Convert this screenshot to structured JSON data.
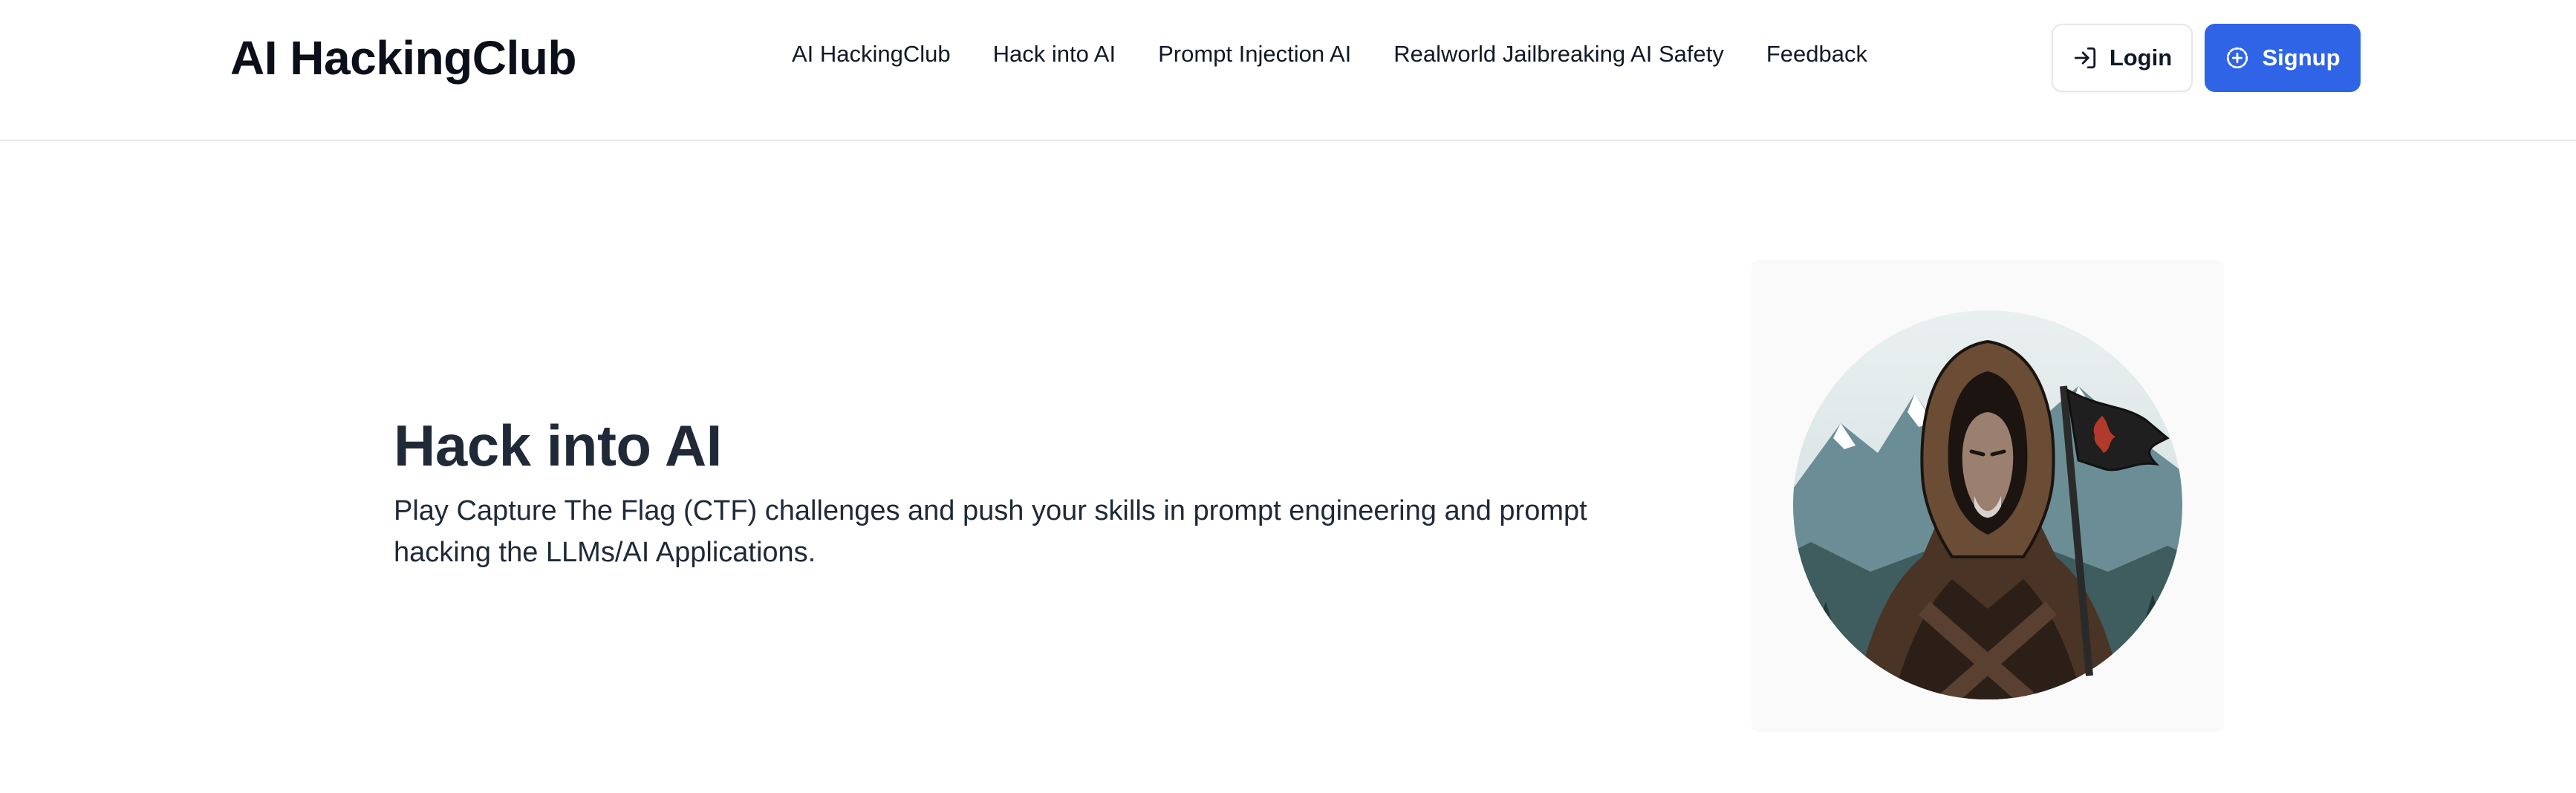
{
  "header": {
    "brand": "AI HackingClub",
    "nav": [
      {
        "label": "AI HackingClub"
      },
      {
        "label": "Hack into AI"
      },
      {
        "label": "Prompt Injection AI"
      },
      {
        "label": "Realworld Jailbreaking AI Safety"
      },
      {
        "label": "Feedback"
      }
    ],
    "login_label": "Login",
    "signup_label": "Signup",
    "login_icon": "login-arrow-icon",
    "signup_icon": "plus-circle-icon"
  },
  "hero": {
    "title": "Hack into AI",
    "description": "Play Capture The Flag (CTF) challenges and push your skills in prompt engineering and prompt hacking the LLMs/AI Applications.",
    "image": "hooded-figure-with-flag-illustration"
  },
  "colors": {
    "accent": "#2f64e6",
    "text": "#111827",
    "border": "#e5e7eb"
  }
}
